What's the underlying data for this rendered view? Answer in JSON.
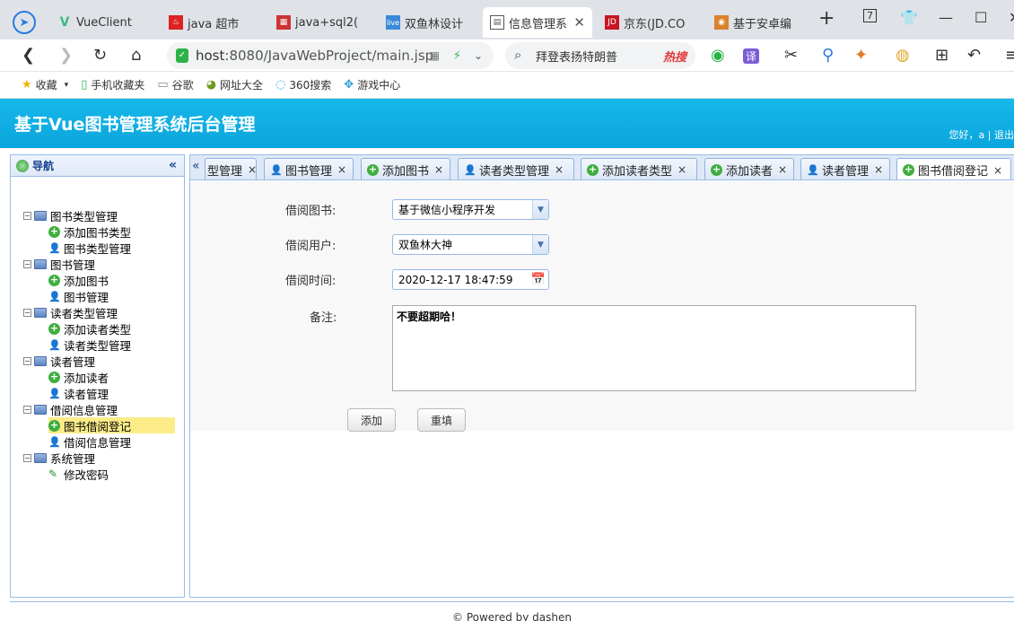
{
  "browser": {
    "tabs": [
      {
        "label": "VueClient"
      },
      {
        "label": "java 超市"
      },
      {
        "label": "java+sql2("
      },
      {
        "label": "双鱼林设计"
      },
      {
        "label": "信息管理系"
      },
      {
        "label": "京东(JD.CO"
      },
      {
        "label": "基于安卓编"
      }
    ],
    "url_host": "host",
    "url_rest": ":8080/JavaWebProject/main.jsp",
    "search_text": "拜登表扬特朗普",
    "hot_label": "热搜",
    "translate_label": "译",
    "bookmarks": [
      {
        "label": "收藏"
      },
      {
        "label": "手机收藏夹"
      },
      {
        "label": "谷歌"
      },
      {
        "label": "网址大全"
      },
      {
        "label": "360搜索"
      },
      {
        "label": "游戏中心"
      }
    ]
  },
  "header": {
    "title": "基于Vue图书管理系统后台管理",
    "welcome": "您好，a | 退出"
  },
  "nav": {
    "title": "导航",
    "collapse": "«",
    "groups": [
      {
        "label": "图书类型管理",
        "items": [
          "添加图书类型",
          "图书类型管理"
        ]
      },
      {
        "label": "图书管理",
        "items": [
          "添加图书",
          "图书管理"
        ]
      },
      {
        "label": "读者类型管理",
        "items": [
          "添加读者类型",
          "读者类型管理"
        ]
      },
      {
        "label": "读者管理",
        "items": [
          "添加读者",
          "读者管理"
        ]
      },
      {
        "label": "借阅信息管理",
        "items": [
          "图书借阅登记",
          "借阅信息管理"
        ]
      },
      {
        "label": "系统管理",
        "items": [
          "修改密码"
        ]
      }
    ]
  },
  "tabs": [
    {
      "label": "型管理"
    },
    {
      "label": "图书管理"
    },
    {
      "label": "添加图书"
    },
    {
      "label": "读者类型管理"
    },
    {
      "label": "添加读者类型"
    },
    {
      "label": "添加读者"
    },
    {
      "label": "读者管理"
    },
    {
      "label": "图书借阅登记"
    }
  ],
  "form": {
    "book_label": "借阅图书:",
    "book_value": "基于微信小程序开发",
    "user_label": "借阅用户:",
    "user_value": "双鱼林大神",
    "time_label": "借阅时间:",
    "time_value": "2020-12-17 18:47:59",
    "remark_label": "备注:",
    "remark_value": "不要超期哈！",
    "add_button": "添加",
    "reset_button": "重填"
  },
  "footer": {
    "text": "© Powered by dashen"
  }
}
